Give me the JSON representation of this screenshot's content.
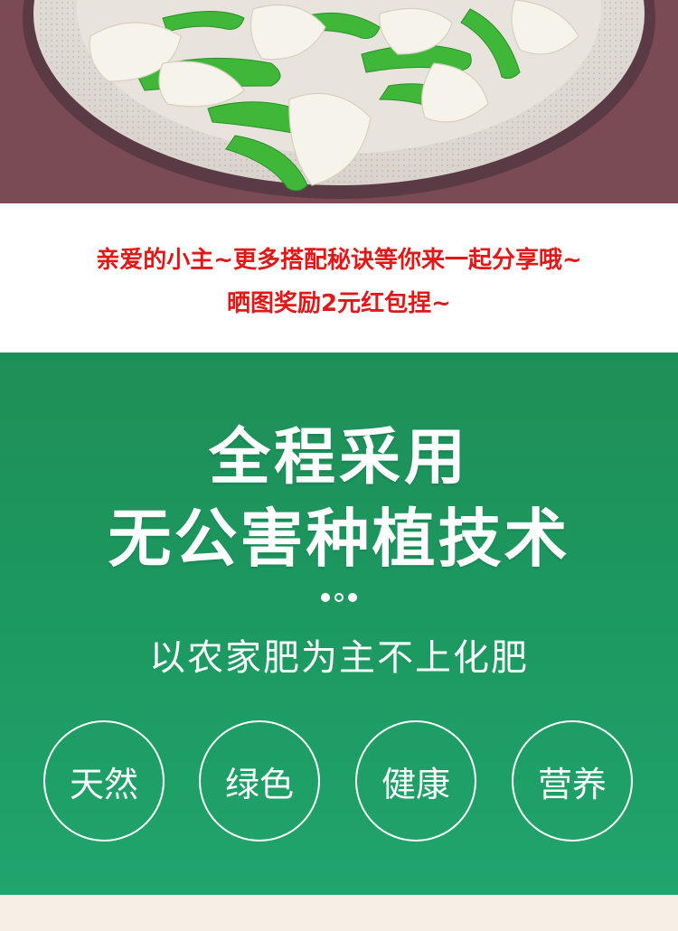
{
  "promo": {
    "line1": "亲爱的小主~更多搭配秘诀等你来一起分享哦~",
    "line2": "晒图奖励2元红包捏~"
  },
  "headline": {
    "line1": "全程采用",
    "line2": "无公害种植技术"
  },
  "subline": "以农家肥为主不上化肥",
  "badges": [
    "天然",
    "绿色",
    "健康",
    "营养"
  ],
  "colors": {
    "promo_red": "#e01818",
    "green_bg": "#1e9a5f",
    "photo_bg": "#7a4a55"
  }
}
